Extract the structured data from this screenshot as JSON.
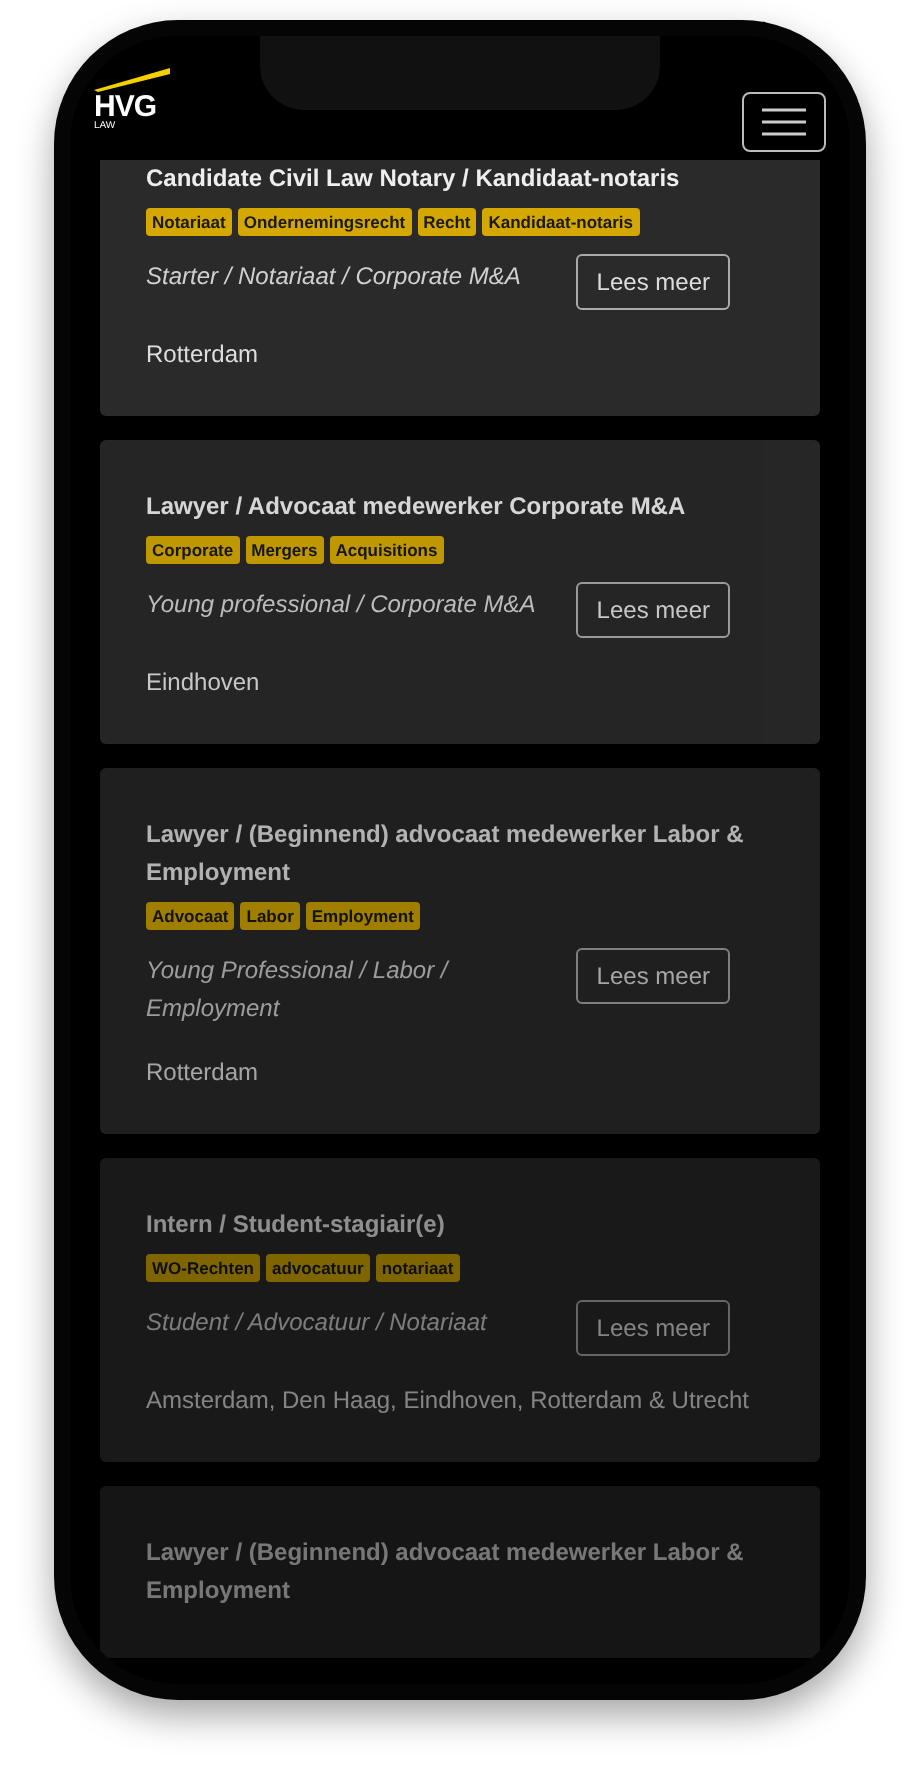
{
  "header": {
    "logo": {
      "name": "HVG",
      "sub": "LAW"
    }
  },
  "jobs": [
    {
      "title": "Candidate Civil Law Notary / Kandidaat-notaris",
      "tags": [
        "Notariaat",
        "Ondernemingsrecht",
        "Recht",
        "Kandidaat-notaris"
      ],
      "category": "Starter / Notariaat / Corporate M&A",
      "button": "Lees meer",
      "location": "Rotterdam"
    },
    {
      "title": "Lawyer / Advocaat medewerker Corporate M&A",
      "tags": [
        "Corporate",
        "Mergers",
        "Acquisitions"
      ],
      "category": "Young professional / Corporate M&A",
      "button": "Lees meer",
      "location": "Eindhoven"
    },
    {
      "title": "Lawyer / (Beginnend) advocaat medewerker Labor & Employment",
      "tags": [
        "Advocaat",
        "Labor",
        "Employment"
      ],
      "category": "Young Professional / Labor / Employment",
      "button": "Lees meer",
      "location": "Rotterdam"
    },
    {
      "title": "Intern / Student-stagiair(e)",
      "tags": [
        "WO-Rechten",
        "advocatuur",
        "notariaat"
      ],
      "category": "Student / Advocatuur / Notariaat",
      "button": "Lees meer",
      "location": "Amsterdam, Den Haag, Eindhoven, Rotterdam & Utrecht"
    },
    {
      "title": "Lawyer / (Beginnend) advocaat medewerker Labor & Employment"
    }
  ]
}
